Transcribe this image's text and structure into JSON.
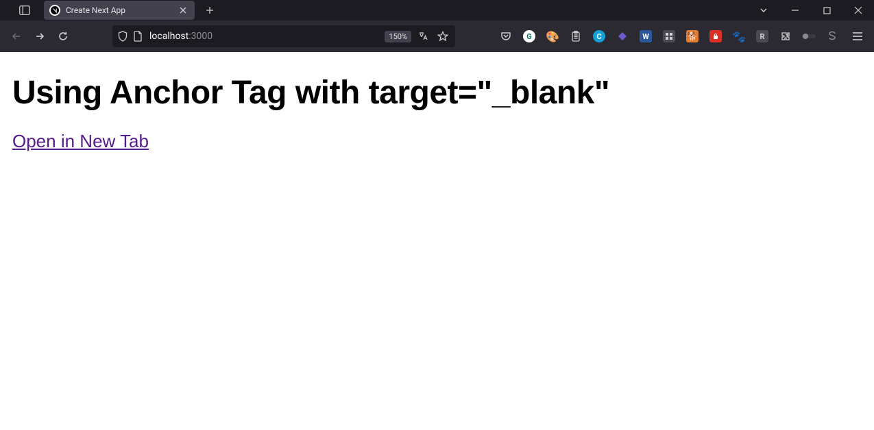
{
  "window": {
    "tabs": {
      "active": {
        "title": "Create Next App"
      }
    }
  },
  "toolbar": {
    "url": {
      "host": "localhost",
      "port": ":3000"
    },
    "zoom": "150%"
  },
  "page": {
    "heading": "Using Anchor Tag with target=\"_blank\"",
    "link_text": "Open in New Tab"
  }
}
